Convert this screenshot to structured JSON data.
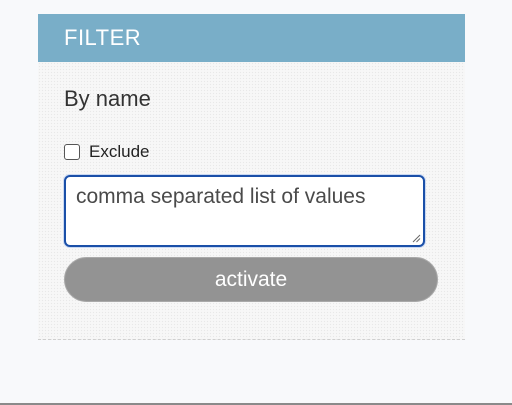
{
  "filter": {
    "header_title": "FILTER",
    "section_title": "By name",
    "exclude_label": "Exclude",
    "exclude_checked": false,
    "values_input": {
      "value": "",
      "placeholder": "comma separated list of values"
    },
    "activate_label": "activate"
  },
  "icons": {
    "resize": "resize-grip-icon"
  },
  "colors": {
    "header_bg": "#79aec8",
    "button_bg": "#939393",
    "input_border": "#1a4fa8"
  }
}
